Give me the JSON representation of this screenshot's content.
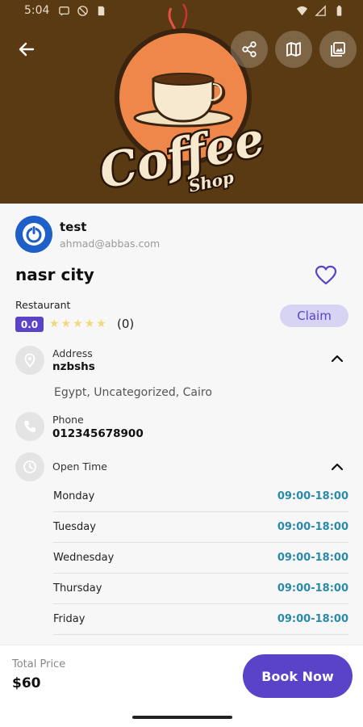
{
  "status_bar": {
    "time": "5:04",
    "left_icons": [
      "message-icon",
      "no-disturb-icon",
      "sim-icon"
    ],
    "right_icons": [
      "wifi-icon",
      "signal-icon",
      "battery-icon"
    ]
  },
  "hero": {
    "logo_title": "Coffee",
    "logo_subtitle": "Shop",
    "actions": [
      "share-icon",
      "map-icon",
      "gallery-icon"
    ]
  },
  "owner": {
    "name": "test",
    "email": "ahmad@abbas.com"
  },
  "listing": {
    "title": "nasr city",
    "category": "Restaurant",
    "rating": "0.0",
    "stars": 5,
    "rating_fraction": 0,
    "review_count": "(0)",
    "claim_label": "Claim"
  },
  "address": {
    "label": "Address",
    "value": "nzbshs",
    "detail": "Egypt, Uncategorized, Cairo"
  },
  "phone": {
    "label": "Phone",
    "value": "012345678900"
  },
  "open_time": {
    "label": "Open Time",
    "days": [
      {
        "day": "Monday",
        "hours": "09:00-18:00"
      },
      {
        "day": "Tuesday",
        "hours": "09:00-18:00"
      },
      {
        "day": "Wednesday",
        "hours": "09:00-18:00"
      },
      {
        "day": "Thursday",
        "hours": "09:00-18:00"
      },
      {
        "day": "Friday",
        "hours": "09:00-18:00"
      }
    ]
  },
  "footer": {
    "total_label": "Total Price",
    "total_value": "$60",
    "book_label": "Book Now"
  },
  "colors": {
    "accent": "#5a43c9",
    "hero_bg": "#5a3a12",
    "hours_text": "#2a8aa8",
    "star_color": "#f2d87a"
  }
}
